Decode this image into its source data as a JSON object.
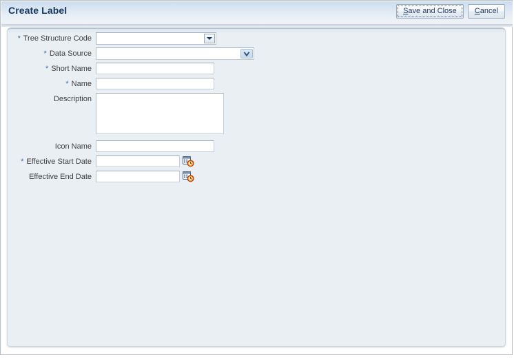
{
  "window": {
    "title": "Create Label"
  },
  "toolbar": {
    "buttons": [
      {
        "id": "save-and-close",
        "label": "Save and Close",
        "accesskey": "S",
        "label_rest": "ave and Close",
        "focused": true
      },
      {
        "id": "cancel",
        "label": "Cancel",
        "accesskey": "C",
        "label_rest": "ancel",
        "focused": false
      }
    ]
  },
  "form": {
    "fields": [
      {
        "name": "tree-structure-code",
        "label": "Tree Structure Code",
        "required": true,
        "type": "select",
        "value": "",
        "placeholder": ""
      },
      {
        "name": "data-source",
        "label": "Data Source",
        "required": true,
        "type": "lov",
        "value": "",
        "placeholder": ""
      },
      {
        "name": "short-name",
        "label": "Short Name",
        "required": true,
        "type": "text",
        "value": "",
        "placeholder": ""
      },
      {
        "name": "name",
        "label": "Name",
        "required": true,
        "type": "text",
        "value": "",
        "placeholder": ""
      },
      {
        "name": "description",
        "label": "Description",
        "required": false,
        "type": "textarea",
        "value": "",
        "placeholder": ""
      },
      {
        "name": "icon-name",
        "label": "Icon Name",
        "required": false,
        "type": "text",
        "value": "",
        "placeholder": ""
      },
      {
        "name": "effective-start-date",
        "label": "Effective Start Date",
        "required": true,
        "type": "date",
        "value": "",
        "placeholder": ""
      },
      {
        "name": "effective-end-date",
        "label": "Effective End Date",
        "required": false,
        "type": "date",
        "value": "",
        "placeholder": ""
      }
    ],
    "required_marker": "*"
  },
  "icons": {
    "date_picker": "calendar-clock-icon",
    "select_arrow": "chevron-down-icon",
    "lov_arrow": "chevron-down-icon"
  },
  "colors": {
    "title": "#15365f",
    "required_star": "#3a6ea5",
    "header_top": "#cbdcef",
    "panel_bg": "#eaeff4",
    "field_border": "#9eadbe",
    "button_text": "#1c3c66"
  }
}
